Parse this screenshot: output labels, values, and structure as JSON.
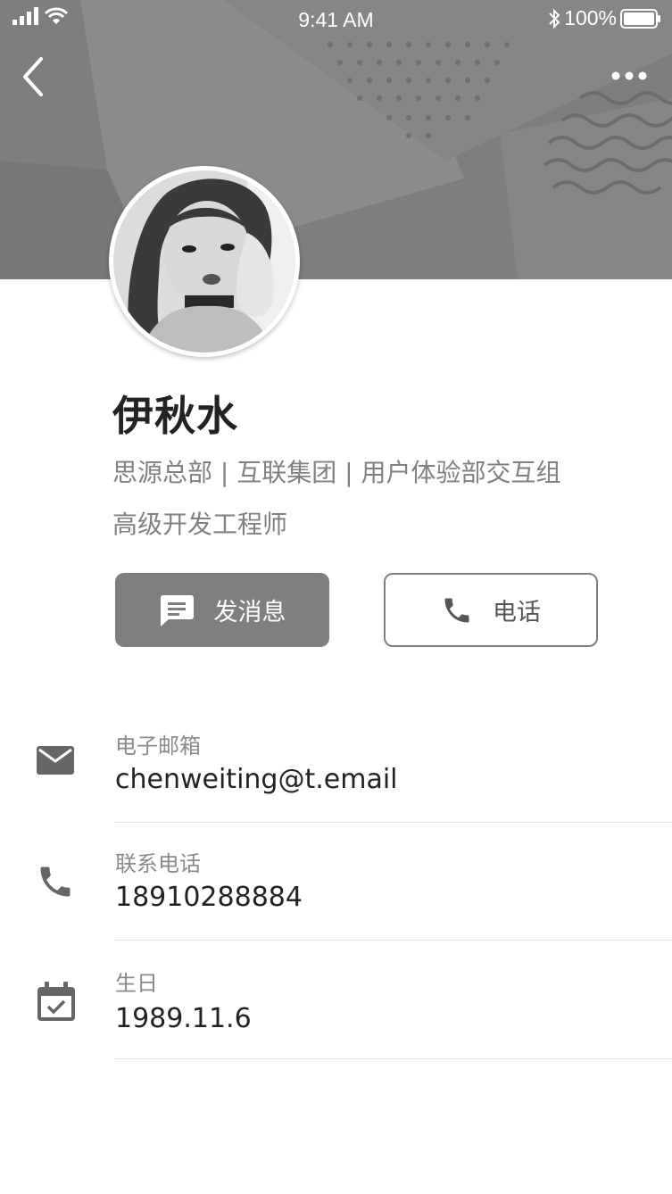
{
  "status_bar": {
    "time": "9:41 AM",
    "battery": "100%"
  },
  "profile": {
    "name": "伊秋水",
    "organization": "思源总部 | 互联集团 | 用户体验部交互组",
    "job_title": "高级开发工程师"
  },
  "actions": {
    "message_label": "发消息",
    "call_label": "电话"
  },
  "info": [
    {
      "label": "电子邮箱",
      "value": "chenweiting@t.email",
      "icon": "mail-icon"
    },
    {
      "label": "联系电话",
      "value": "18910288884",
      "icon": "phone-icon"
    },
    {
      "label": "生日",
      "value": "1989.11.6",
      "icon": "calendar-icon"
    }
  ],
  "colors": {
    "header": "#808080",
    "primary_button": "#7f7f7f",
    "text_primary": "#222222",
    "text_secondary": "#808080",
    "icon": "#666666"
  }
}
